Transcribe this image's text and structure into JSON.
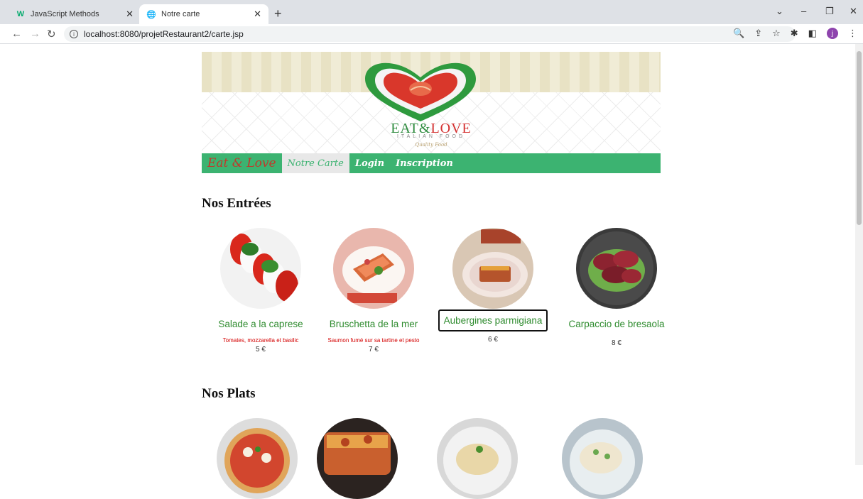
{
  "browser": {
    "tabs": [
      {
        "title": "JavaScript Methods",
        "icon": "w3schools-icon",
        "active": false
      },
      {
        "title": "Notre carte",
        "icon": "globe-icon",
        "active": true
      }
    ],
    "url": "localhost:8080/projetRestaurant2/carte.jsp"
  },
  "logo": {
    "eat": "EAT",
    "amp": "&",
    "love": "LOVE",
    "sub": "ITALIAN FOOD",
    "quality": "Quality Food"
  },
  "menu": {
    "brand": "Eat & Love",
    "carte": "Notre Carte",
    "login": "Login",
    "inscription": "Inscription"
  },
  "sections": {
    "entrees": "Nos Entrées",
    "plats": "Nos Plats"
  },
  "entrees": [
    {
      "name": "Salade a la caprese",
      "desc": "Tomates, mozzarella et basilic",
      "price": "5 €"
    },
    {
      "name": "Bruschetta de la mer",
      "desc": "Saumon fumé sur sa tartine et pesto",
      "price": "7 €"
    },
    {
      "name": "Aubergines parmigiana",
      "desc": "",
      "price": "6 €"
    },
    {
      "name": "Carpaccio de bresaola",
      "desc": "",
      "price": "8 €"
    }
  ],
  "colors": {
    "menu_green": "#3cb371",
    "item_green": "#2e8b2e",
    "desc_red": "#d40000"
  }
}
